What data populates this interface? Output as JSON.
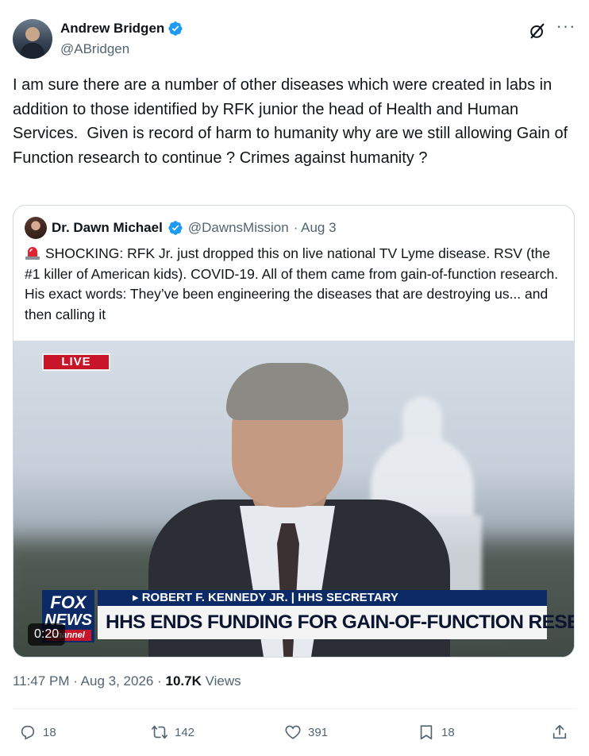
{
  "post": {
    "author": {
      "display_name": "Andrew Bridgen",
      "handle": "@ABridgen",
      "verified": true
    },
    "text": "I am sure there are a number of other diseases which were created in labs in addition to those identified by RFK junior the head of Health and Human Services.  Given is record of harm to humanity why are we still allowing Gain of Function research to continue ? Crimes against humanity ?",
    "timestamp": "11:47 PM · Aug 3, 2026 · ",
    "views_count": "10.7K",
    "views_label": " Views"
  },
  "quote": {
    "display_name": "Dr. Dawn Michael",
    "handle": "@DawnsMission",
    "date": "· Aug 3",
    "text": "SHOCKING: RFK Jr. just dropped this on live national TV Lyme disease. RSV (the #1 killer of American kids). COVID-19. All of them came from gain-of-function research. His exact words: They’ve been engineering the diseases that are destroying us... and then calling it"
  },
  "video": {
    "live_label": "LIVE",
    "lower_third_top": "▸ ROBERT F. KENNEDY JR. | HHS SECRETARY",
    "lower_third_main": "HHS ENDS FUNDING FOR GAIN-OF-FUNCTION RESEARCH",
    "logo_line1": "FOX",
    "logo_line2": "NEWS",
    "logo_line3": "channel",
    "duration": "0:20"
  },
  "actions": {
    "replies": "18",
    "reposts": "142",
    "likes": "391",
    "bookmarks": "18"
  },
  "colors": {
    "verified_blue": "#1d9bf0",
    "secondary_text": "#536471",
    "fox_navy": "#0b2a66",
    "live_red": "#c8152a"
  },
  "icons": {
    "reply": "reply-icon",
    "repost": "repost-icon",
    "like": "heart-icon",
    "bookmark": "bookmark-icon",
    "share": "share-icon",
    "grok": "grok-icon",
    "more": "more-icon"
  }
}
